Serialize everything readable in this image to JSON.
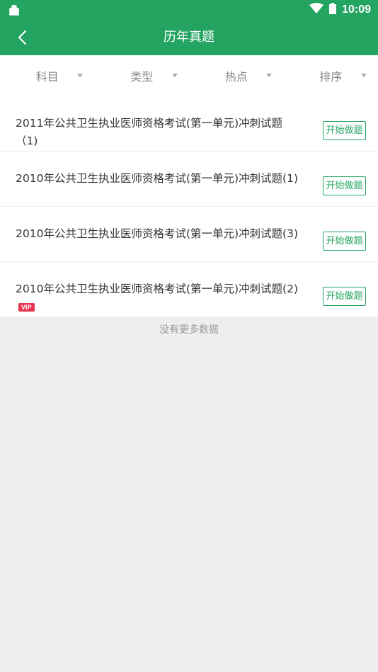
{
  "status_bar": {
    "time": "10:09"
  },
  "header": {
    "title": "历年真题"
  },
  "filters": [
    {
      "label": "科目"
    },
    {
      "label": "类型"
    },
    {
      "label": "热点"
    },
    {
      "label": "排序"
    }
  ],
  "items": [
    {
      "title": "2011年公共卫生执业医师资格考试(第一单元)冲刺试题（1)",
      "button": "开始做题",
      "vip": ""
    },
    {
      "title": "2010年公共卫生执业医师资格考试(第一单元)冲刺试题(1)",
      "button": "开始做题",
      "vip": ""
    },
    {
      "title": "2010年公共卫生执业医师资格考试(第一单元)冲刺试题(3)",
      "button": "开始做题",
      "vip": ""
    },
    {
      "title": "2010年公共卫生执业医师资格考试(第一单元)冲刺试题(2)",
      "button": "开始做题",
      "vip": "VIP"
    }
  ],
  "footer": {
    "no_more": "没有更多数据"
  },
  "colors": {
    "primary": "#23a461",
    "vip": "#e8344f"
  }
}
